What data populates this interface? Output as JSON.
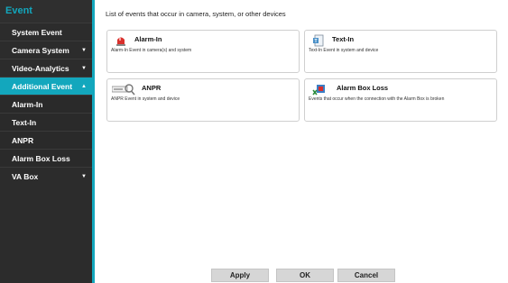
{
  "sidebar": {
    "title": "Event",
    "items": [
      {
        "label": "System Event",
        "caret": ""
      },
      {
        "label": "Camera System",
        "caret": "▼"
      },
      {
        "label": "Video-Analytics",
        "caret": "▼"
      },
      {
        "label": "Additional Event",
        "caret": "▲"
      },
      {
        "label": "Alarm-In",
        "caret": ""
      },
      {
        "label": "Text-In",
        "caret": ""
      },
      {
        "label": "ANPR",
        "caret": ""
      },
      {
        "label": "Alarm Box Loss",
        "caret": ""
      },
      {
        "label": "VA Box",
        "caret": "▼"
      }
    ]
  },
  "main": {
    "description": "List of events that occur in camera, system, or other devices",
    "cards": [
      {
        "title": "Alarm-In",
        "subtitle": "Alarm-In Event in camera(s) and system",
        "icon": "alarm-siren-icon"
      },
      {
        "title": "Text-In",
        "subtitle": "Text-In Event in system and device",
        "icon": "text-document-icon"
      },
      {
        "title": "ANPR",
        "subtitle": "ANPR Event in system and device",
        "icon": "license-plate-magnifier-icon"
      },
      {
        "title": "Alarm Box Loss",
        "subtitle": "Events that occur when the connection with the Alarm Box is broken",
        "icon": "alarm-box-disconnect-icon"
      }
    ]
  },
  "buttons": {
    "apply": "Apply",
    "ok": "OK",
    "cancel": "Cancel"
  },
  "colors": {
    "accent": "#13a7bd",
    "sidebar_bg": "#2c2c2c"
  }
}
